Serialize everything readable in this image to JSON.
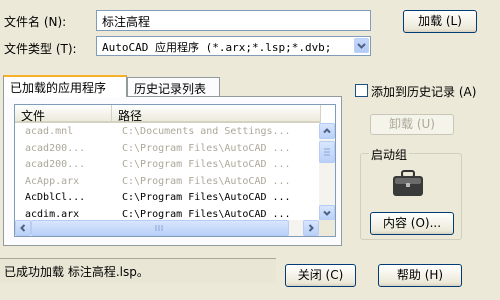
{
  "filename": {
    "label": "文件名 (N):",
    "value": "标注高程"
  },
  "filetype": {
    "label": "文件类型 (T):",
    "value": "AutoCAD 应用程序 (*.arx;*.lsp;*.dvb;"
  },
  "load_button": "加载 (L)",
  "tabs": [
    "已加载的应用程序",
    "历史记录列表"
  ],
  "add_history_checkbox": {
    "label": "添加到历史记录 (A)",
    "checked": false
  },
  "unload_button": "卸载 (U)",
  "startup_group": {
    "title": "启动组",
    "icon": "briefcase-icon",
    "contents_button": "内容 (O)..."
  },
  "list": {
    "columns": [
      "文件",
      "路径"
    ],
    "rows": [
      {
        "file": "acad.mnl",
        "path": "C:\\Documents and Settings...",
        "disabled": true
      },
      {
        "file": "acad200...",
        "path": "C:\\Program Files\\AutoCAD ...",
        "disabled": true
      },
      {
        "file": "acad200...",
        "path": "C:\\Program Files\\AutoCAD ...",
        "disabled": true
      },
      {
        "file": "AcApp.arx",
        "path": "C:\\Program Files\\AutoCAD ...",
        "disabled": true
      },
      {
        "file": "AcDblCl...",
        "path": "C:\\Program Files\\AutoCAD ...",
        "disabled": false
      },
      {
        "file": "acdim.arx",
        "path": "C:\\Program Files\\AutoCAD ...",
        "disabled": false
      }
    ]
  },
  "status": "已成功加载 标注高程.lsp。",
  "close_button": "关闭 (C)",
  "help_button": "帮助 (H)"
}
